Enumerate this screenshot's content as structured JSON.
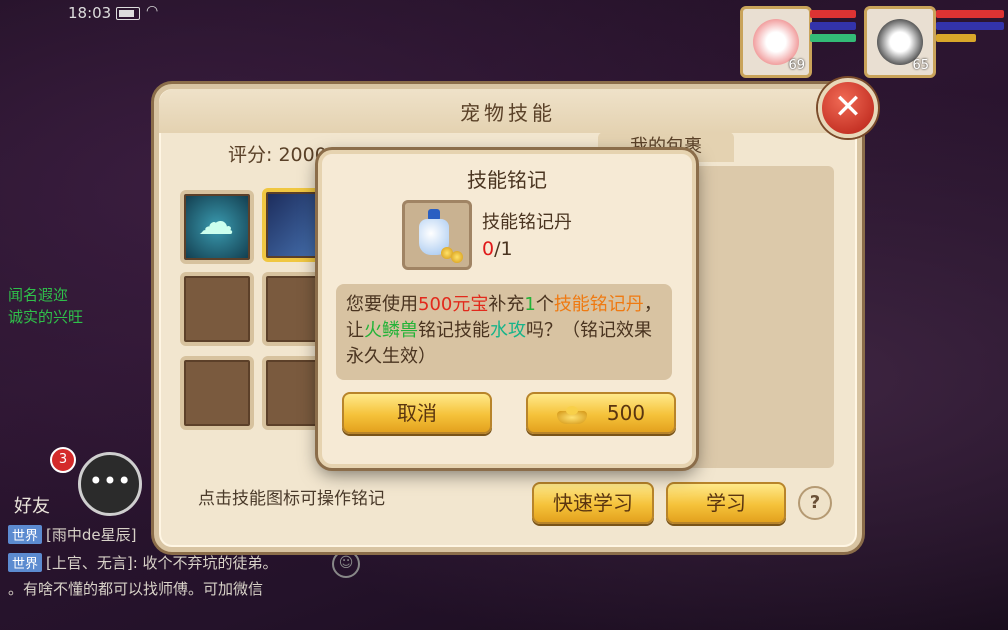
{
  "status_bar": {
    "time": "18:03"
  },
  "pets": [
    {
      "level": "69"
    },
    {
      "level": "65"
    }
  ],
  "left_chat": {
    "lines_green": [
      "闻名遐迩",
      "诚实的兴旺"
    ],
    "friends_badge": "3",
    "friends_label": "好友",
    "messages": [
      {
        "tag": "世界",
        "text": "[雨中de星辰]"
      },
      {
        "tag": "世界",
        "text": "[上官、无言]: 收个不弃坑的徒弟。"
      },
      {
        "tag": "",
        "text": "。有啥不懂的都可以找师傅。可加微信"
      }
    ]
  },
  "main_panel": {
    "title": "宠物技能",
    "score_label": "评分: 2000",
    "tab_bag": "我的包裹",
    "hint": "点击技能图标可操作铭记",
    "quick_learn_button": "快速学习",
    "learn_button": "学习",
    "help_icon": "?"
  },
  "dialog": {
    "title": "技能铭记",
    "item_name": "技能铭记丹",
    "item_have": "0",
    "item_need": "/1",
    "msg_parts": {
      "p1": "您要使用",
      "cost": "500元宝",
      "p2": "补充",
      "num": "1",
      "p3": "个",
      "item": "技能铭记丹",
      "p4": "，让",
      "pet": "火鳞兽",
      "p5": "铭记技能",
      "skill": "水攻",
      "p6": "吗？（铭记效果永久生效）"
    },
    "cancel_button": "取消",
    "confirm_amount": "500"
  },
  "colors": {
    "accent_gold": "#f5c23a",
    "panel_bg": "#f2e6cf",
    "cost_red": "#e22a1c",
    "item_orange": "#ef7a12",
    "pet_green": "#23b338"
  }
}
